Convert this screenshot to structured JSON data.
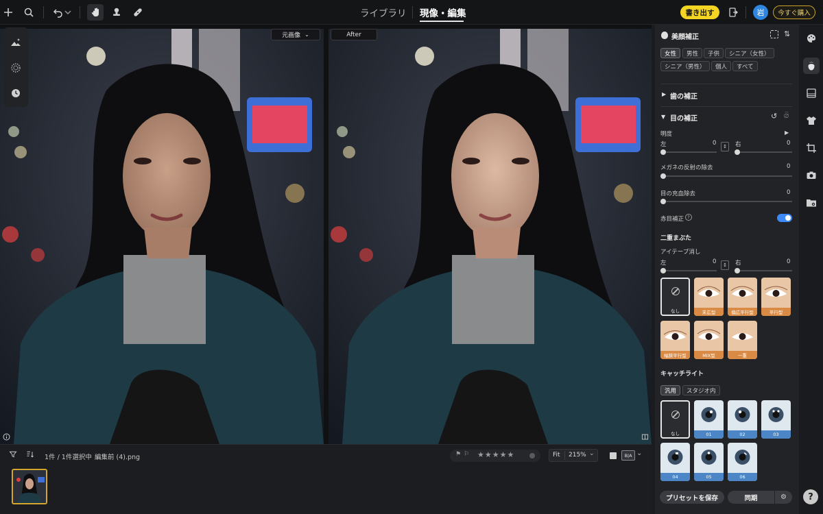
{
  "topbar": {
    "tabs": [
      {
        "label": "ライブラリ",
        "active": false
      },
      {
        "label": "現像・編集",
        "active": true
      }
    ],
    "export_label": "書き出す",
    "avatar_initial": "岩",
    "buy_label": "今すぐ購入"
  },
  "viewer": {
    "compare_mode": "元画像",
    "after_label": "After"
  },
  "filmstrip": {
    "selection_status": "1件 / 1件選択中",
    "filename": "編集前 (4).png",
    "fit_label": "Fit",
    "zoom": "215%",
    "view_mode_label": "B|A"
  },
  "panel": {
    "section_title": "美顔補正",
    "filter_chips": [
      "女性",
      "男性",
      "子供",
      "シニア（女性）",
      "シニア（男性）",
      "個人",
      "すべて"
    ],
    "selected_filter": "女性",
    "teeth_section": "歯の補正",
    "eye_section": "目の補正",
    "brightness_label": "明度",
    "left_label": "左",
    "right_label": "右",
    "brightness_left": "0",
    "brightness_right": "0",
    "glasses_label": "メガネの反射の除去",
    "glasses_value": "0",
    "bloodshot_label": "目の充血除去",
    "bloodshot_value": "0",
    "redeye_label": "赤目補正",
    "redeye_on": true,
    "double_eyelid_title": "二重まぶた",
    "eyetape_label": "アイテープ消し",
    "eyetape_left": "0",
    "eyetape_right": "0",
    "eyelid_presets": [
      "なし",
      "末広型",
      "偏広平行型",
      "平行型",
      "幅狭平行型",
      "MIX型",
      "一重"
    ],
    "catchlight_title": "キャッチライト",
    "catchlight_chips": [
      "汎用",
      "スタジオ内"
    ],
    "catchlight_presets": [
      "なし",
      "01",
      "02",
      "03",
      "04",
      "05",
      "06"
    ],
    "save_preset_label": "プリセットを保存",
    "sync_label": "同期"
  },
  "help_label": "?",
  "colors": {
    "accent_yellow": "#f5d524",
    "toggle_blue": "#3d8af7",
    "avatar_blue": "#2e86de"
  }
}
